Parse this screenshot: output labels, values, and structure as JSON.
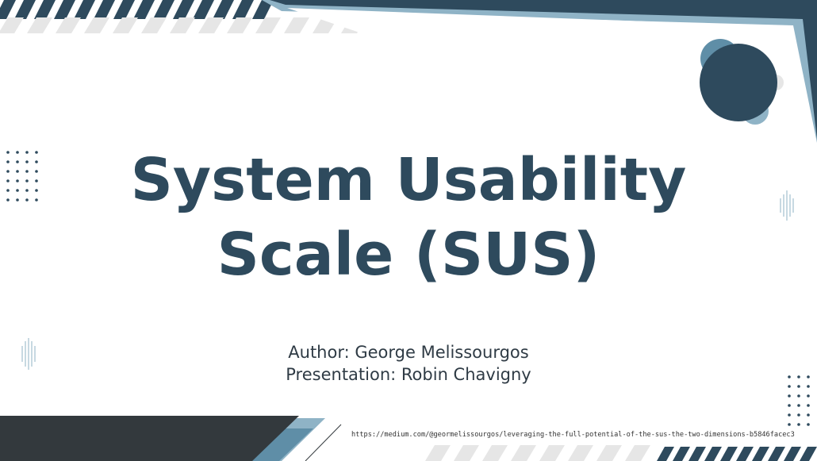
{
  "slide": {
    "title_line1": "System Usability",
    "title_line2": "Scale (SUS)",
    "author_line": "Author: George Melissourgos",
    "presenter_line": "Presentation: Robin Chavigny",
    "source_url": "https://medium.com/@geormelissourgos/leveraging-the-full-potential-of-the-sus-the-two-dimensions-b5846facec3"
  },
  "colors": {
    "navy": "#2e4a5d",
    "steel_blue": "#5f8ea7",
    "light_blue": "#8fb3c6",
    "charcoal": "#33393d",
    "stripe_gray": "#e6e6e6"
  }
}
